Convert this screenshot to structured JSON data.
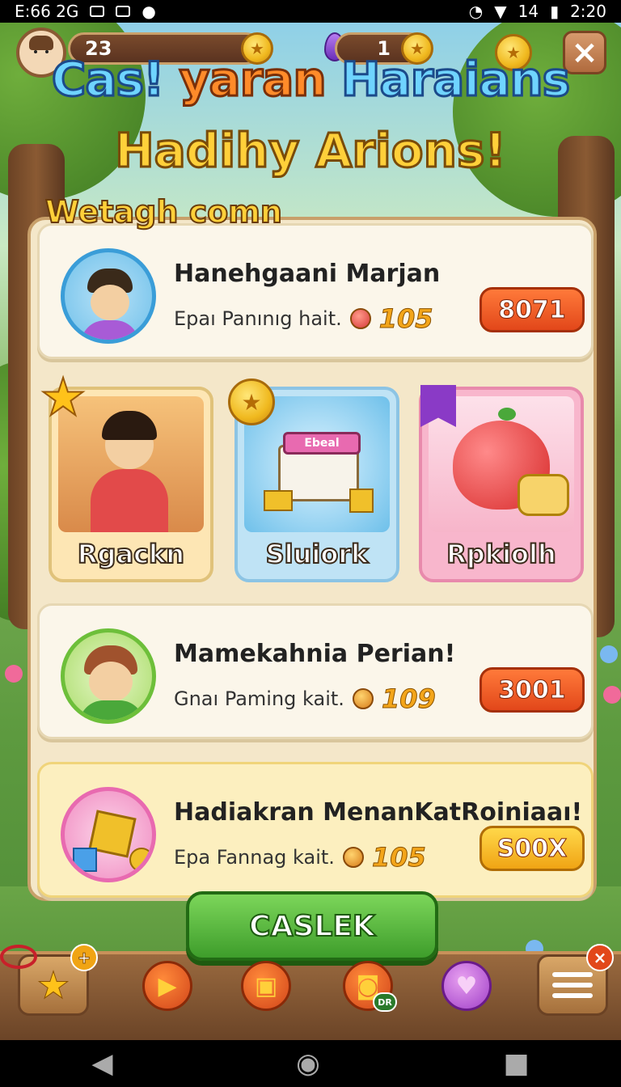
{
  "status_bar": {
    "left_text": "E:66 2G",
    "time": "2:20",
    "signal_text": "14"
  },
  "hud": {
    "player_level": "23",
    "gem_count": "1",
    "close_label": "×"
  },
  "title": {
    "line1_part1": "Cas!",
    "line1_part2": "yaran",
    "line1_part3": "Haraians",
    "line2": "Hadihy Arions!"
  },
  "section_title": "Wetagh comn",
  "offers": [
    {
      "title": "Hanehgaani Marjan",
      "subtitle": "Epaı Panınıg hait.",
      "amount": "105",
      "button_label": "8071"
    },
    {
      "title": "Mamekahnia Perian!",
      "subtitle": "Gnaı Paming kait.",
      "amount": "109",
      "button_label": "3001"
    },
    {
      "title": "Hadiakran MenanKatRoiniaaı!",
      "subtitle": "Epa Fannag kait.",
      "amount": "105",
      "button_label": "S00X"
    }
  ],
  "tiles": [
    {
      "label": "Rgackn"
    },
    {
      "label": "Sluiork",
      "sign_text": "Ebeal"
    },
    {
      "label": "Rpkiolh"
    }
  ],
  "main_button_label": "CASLEK",
  "nav": {
    "home_badge": "+",
    "menu_badge": "×",
    "chest_badge": "DR"
  },
  "colors": {
    "accent_green": "#3e9d2b",
    "button_orange": "#e2471a",
    "button_yellow": "#f0a414",
    "coin_gold": "#f0b91f"
  },
  "icons": [
    "avatar",
    "coin-icon",
    "gem-icon",
    "close-icon",
    "star-icon",
    "home-icon",
    "play-icon",
    "shop-icon",
    "chest-icon",
    "heart-icon",
    "menu-icon"
  ]
}
